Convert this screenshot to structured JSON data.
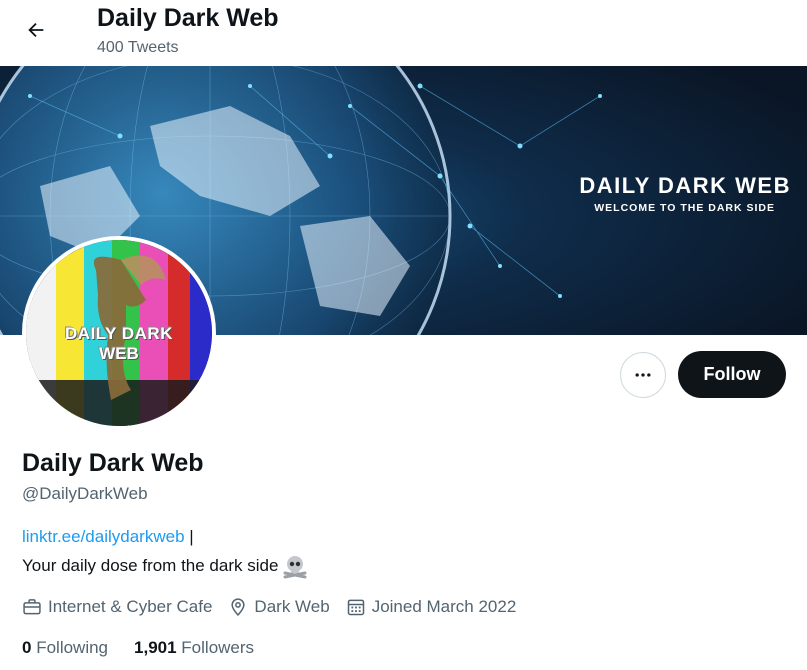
{
  "header": {
    "title": "Daily Dark Web",
    "tweet_count": "400 Tweets"
  },
  "banner": {
    "title": "DAILY DARK WEB",
    "subtitle": "WELCOME TO THE DARK SIDE"
  },
  "avatar": {
    "line1": "DAILY DARK",
    "line2": "WEB"
  },
  "actions": {
    "more_icon": "more-horizontal-icon",
    "follow_label": "Follow"
  },
  "profile": {
    "name": "Daily Dark Web",
    "handle": "@DailyDarkWeb",
    "bio_link": "linktr.ee/dailydarkweb",
    "bio_separator": " |",
    "bio_text": "Your daily dose from the dark side",
    "bio_emoji": "skull-crossbones-icon",
    "category": "Internet & Cyber Cafe",
    "location": "Dark Web",
    "joined": "Joined March 2022"
  },
  "stats": {
    "following_count": "0",
    "following_label": "Following",
    "followers_count": "1,901",
    "followers_label": "Followers"
  },
  "colors": {
    "link": "#1d9bf0",
    "secondary_text": "#536471",
    "primary_text": "#0f1419",
    "follow_bg": "#0f1419"
  }
}
